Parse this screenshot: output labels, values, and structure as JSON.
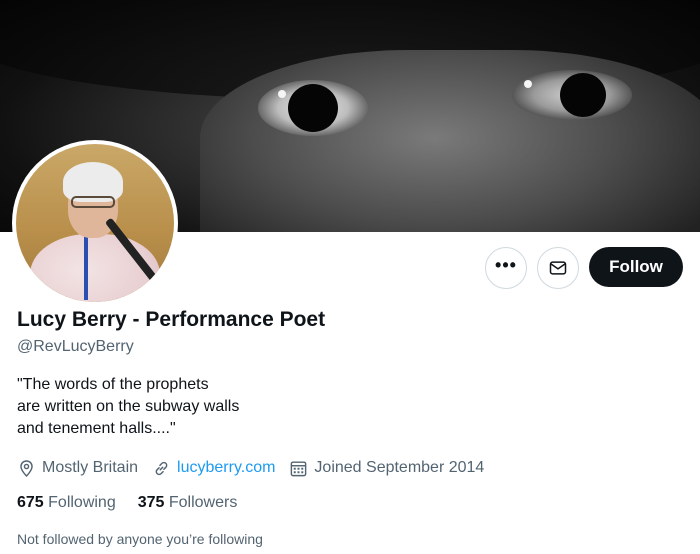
{
  "profile": {
    "name": "Lucy Berry - Performance Poet",
    "handle": "@RevLucyBerry",
    "bio_lines": [
      "\"The words of the prophets",
      "are written on the subway walls",
      "and tenement halls....\""
    ],
    "location": "Mostly Britain",
    "website": "lucyberry.com",
    "joined": "Joined September 2014",
    "following_count": "675",
    "following_label": "Following",
    "followers_count": "375",
    "followers_label": "Followers",
    "mutuals_note": "Not followed by anyone you’re following"
  },
  "actions": {
    "more_label": "•••",
    "follow_label": "Follow"
  },
  "icons": {
    "more": "more-icon",
    "message": "mail-icon",
    "location": "location-pin-icon",
    "link": "link-icon",
    "calendar": "calendar-icon"
  },
  "colors": {
    "link": "#1d9bf0",
    "secondary_text": "#536471",
    "follow_button": "#0f1419"
  }
}
